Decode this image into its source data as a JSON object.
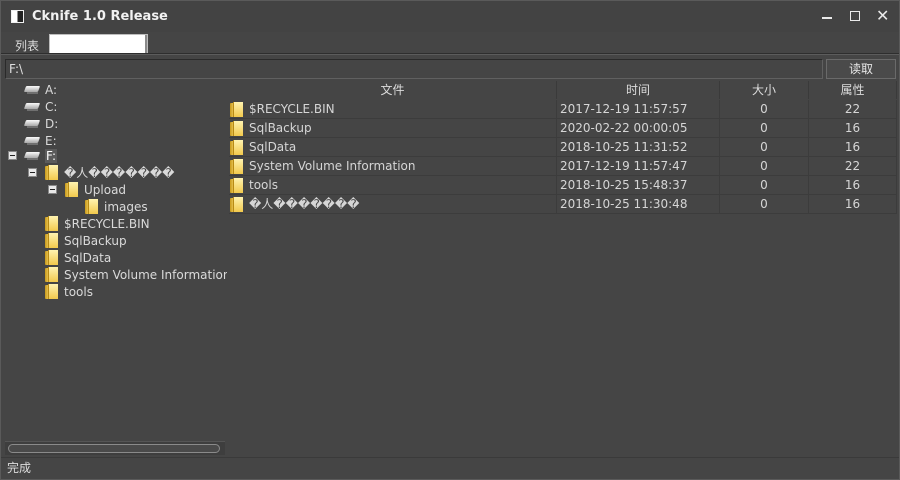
{
  "window": {
    "title": "Cknife 1.0 Release"
  },
  "tabs": {
    "label": "列表",
    "active_tab_text": ""
  },
  "address": {
    "path": "F:\\",
    "read_label": "读取"
  },
  "tree": {
    "drives": [
      {
        "label": "A:"
      },
      {
        "label": "C:"
      },
      {
        "label": "D:"
      },
      {
        "label": "E:"
      },
      {
        "label": "F:"
      }
    ],
    "folders": [
      {
        "label": "�人�������"
      },
      {
        "label": "Upload"
      },
      {
        "label": "images"
      },
      {
        "label": "$RECYCLE.BIN"
      },
      {
        "label": "SqlBackup"
      },
      {
        "label": "SqlData"
      },
      {
        "label": "System Volume Information"
      },
      {
        "label": "tools"
      }
    ]
  },
  "table": {
    "columns": [
      "文件",
      "时间",
      "大小",
      "属性"
    ],
    "rows": [
      {
        "name": "$RECYCLE.BIN",
        "time": "2017-12-19 11:57:57",
        "size": "0",
        "attr": "22"
      },
      {
        "name": "SqlBackup",
        "time": "2020-02-22 00:00:05",
        "size": "0",
        "attr": "16"
      },
      {
        "name": "SqlData",
        "time": "2018-10-25 11:31:52",
        "size": "0",
        "attr": "16"
      },
      {
        "name": "System Volume Information",
        "time": "2017-12-19 11:57:47",
        "size": "0",
        "attr": "22"
      },
      {
        "name": "tools",
        "time": "2018-10-25 15:48:37",
        "size": "0",
        "attr": "16"
      },
      {
        "name": "�人�������",
        "time": "2018-10-25 11:30:48",
        "size": "0",
        "attr": "16"
      }
    ]
  },
  "status": {
    "text": "完成"
  },
  "icons": {
    "app": "app-icon",
    "minimize": "minimize-icon",
    "maximize": "maximize-icon",
    "close": "close-icon",
    "drive": "drive-icon",
    "folder": "folder-icon",
    "expander": "collapse-icon"
  }
}
